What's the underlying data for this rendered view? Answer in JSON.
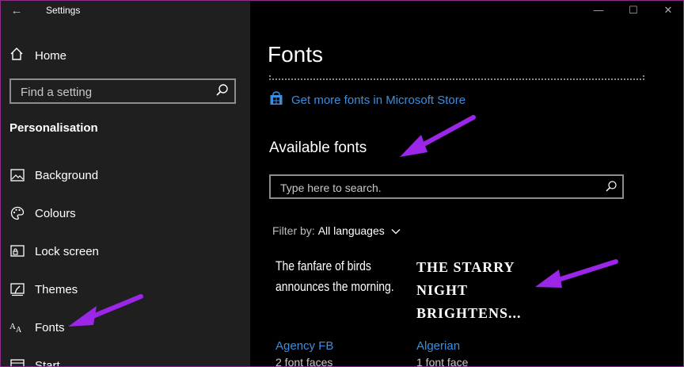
{
  "window": {
    "title": "Settings",
    "back_glyph": "←",
    "controls": {
      "minimize": "—",
      "maximize": "☐",
      "close": "✕"
    }
  },
  "sidebar": {
    "home_label": "Home",
    "search_placeholder": "Find a setting",
    "section_heading": "Personalisation",
    "items": [
      {
        "label": "Background",
        "icon": "picture-icon"
      },
      {
        "label": "Colours",
        "icon": "palette-icon"
      },
      {
        "label": "Lock screen",
        "icon": "lock-screen-icon"
      },
      {
        "label": "Themes",
        "icon": "themes-icon"
      },
      {
        "label": "Fonts",
        "icon": "fonts-icon"
      },
      {
        "label": "Start",
        "icon": "start-icon"
      }
    ]
  },
  "main": {
    "page_title": "Fonts",
    "store_link": "Get more fonts in Microsoft Store",
    "available_heading": "Available fonts",
    "search_placeholder": "Type here to search.",
    "filter_label": "Filter by:",
    "filter_value": "All languages",
    "fonts": [
      {
        "sample": "The fanfare of birds announces the morning.",
        "name": "Agency FB",
        "faces": "2 font faces"
      },
      {
        "sample": "THE STARRY NIGHT BRIGHTENS...",
        "name": "Algerian",
        "faces": "1 font face"
      }
    ]
  },
  "colors": {
    "accent_link": "#3a8fe0",
    "annotation_arrow": "#9b26e8",
    "sidebar_bg": "#1f1f1f",
    "main_bg": "#000000"
  }
}
